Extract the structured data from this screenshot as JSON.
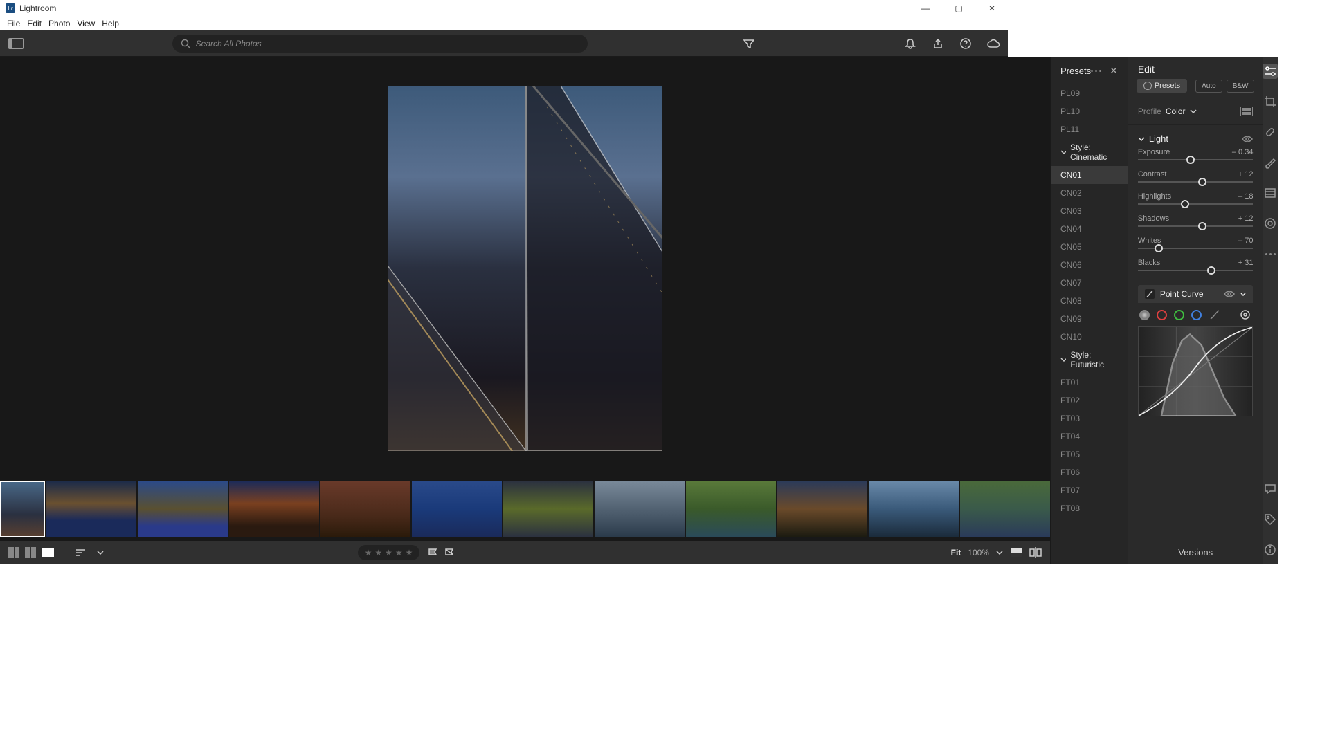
{
  "app": {
    "title": "Lightroom"
  },
  "menu": [
    "File",
    "Edit",
    "Photo",
    "View",
    "Help"
  ],
  "search": {
    "placeholder": "Search All Photos"
  },
  "presets": {
    "title": "Presets",
    "items": [
      {
        "type": "item",
        "label": "PL09"
      },
      {
        "type": "item",
        "label": "PL10"
      },
      {
        "type": "item",
        "label": "PL11"
      },
      {
        "type": "group",
        "label": "Style: Cinematic"
      },
      {
        "type": "item",
        "label": "CN01",
        "selected": true
      },
      {
        "type": "item",
        "label": "CN02"
      },
      {
        "type": "item",
        "label": "CN03"
      },
      {
        "type": "item",
        "label": "CN04"
      },
      {
        "type": "item",
        "label": "CN05"
      },
      {
        "type": "item",
        "label": "CN06"
      },
      {
        "type": "item",
        "label": "CN07"
      },
      {
        "type": "item",
        "label": "CN08"
      },
      {
        "type": "item",
        "label": "CN09"
      },
      {
        "type": "item",
        "label": "CN10"
      },
      {
        "type": "group",
        "label": "Style: Futuristic"
      },
      {
        "type": "item",
        "label": "FT01"
      },
      {
        "type": "item",
        "label": "FT02"
      },
      {
        "type": "item",
        "label": "FT03"
      },
      {
        "type": "item",
        "label": "FT04"
      },
      {
        "type": "item",
        "label": "FT05"
      },
      {
        "type": "item",
        "label": "FT06"
      },
      {
        "type": "item",
        "label": "FT07"
      },
      {
        "type": "item",
        "label": "FT08"
      }
    ]
  },
  "edit": {
    "title": "Edit",
    "presets_btn": "Presets",
    "auto_btn": "Auto",
    "bw_btn": "B&W",
    "profile_label": "Profile",
    "profile_value": "Color",
    "light_label": "Light",
    "sliders": [
      {
        "name": "Exposure",
        "value": "– 0.34",
        "pos": 46
      },
      {
        "name": "Contrast",
        "value": "+ 12",
        "pos": 56
      },
      {
        "name": "Highlights",
        "value": "– 18",
        "pos": 41
      },
      {
        "name": "Shadows",
        "value": "+ 12",
        "pos": 56
      },
      {
        "name": "Whites",
        "value": "– 70",
        "pos": 18
      },
      {
        "name": "Blacks",
        "value": "+ 31",
        "pos": 64
      }
    ],
    "point_curve": "Point Curve",
    "versions": "Versions"
  },
  "zoom": {
    "fit": "Fit",
    "pct": "100%"
  },
  "thumbs": [
    {
      "bg": "linear-gradient(180deg,#4a6a8a 0%,#2a3040 60%,#5a4030 100%)",
      "sel": true
    },
    {
      "bg": "linear-gradient(180deg,#1a2a4a 0%,#6a5030 40%,#1a2a5a 70%)"
    },
    {
      "bg": "linear-gradient(180deg,#2a4a8a 0%,#5a5030 50%,#2a3a8a 80%)"
    },
    {
      "bg": "linear-gradient(180deg,#1a2a5a 0%,#7a4020 40%,#2a1a10 80%)"
    },
    {
      "bg": "linear-gradient(180deg,#6a3a2a 0%,#4a2a1a 60%,#2a1a0a 100%)"
    },
    {
      "bg": "linear-gradient(180deg,#2a4a8a 0%,#1a3a7a 50%,#1a2a5a 100%)"
    },
    {
      "bg": "linear-gradient(180deg,#2a3040 0%,#5a6a2a 50%,#2a3040 100%)"
    },
    {
      "bg": "linear-gradient(180deg,#7a8a9a 0%,#5a6a7a 40%,#2a3a4a 100%)"
    },
    {
      "bg": "linear-gradient(180deg,#5a7a3a 0%,#3a5a2a 50%,#2a4a5a 100%)"
    },
    {
      "bg": "linear-gradient(180deg,#2a3a5a 0%,#6a4a2a 50%,#1a1a10 100%)"
    },
    {
      "bg": "linear-gradient(180deg,#6a8aaa 0%,#3a5a7a 50%,#1a2a3a 100%)"
    },
    {
      "bg": "linear-gradient(180deg,#4a6a3a 0%,#3a5a4a 50%,#2a3a5a 100%)"
    }
  ]
}
